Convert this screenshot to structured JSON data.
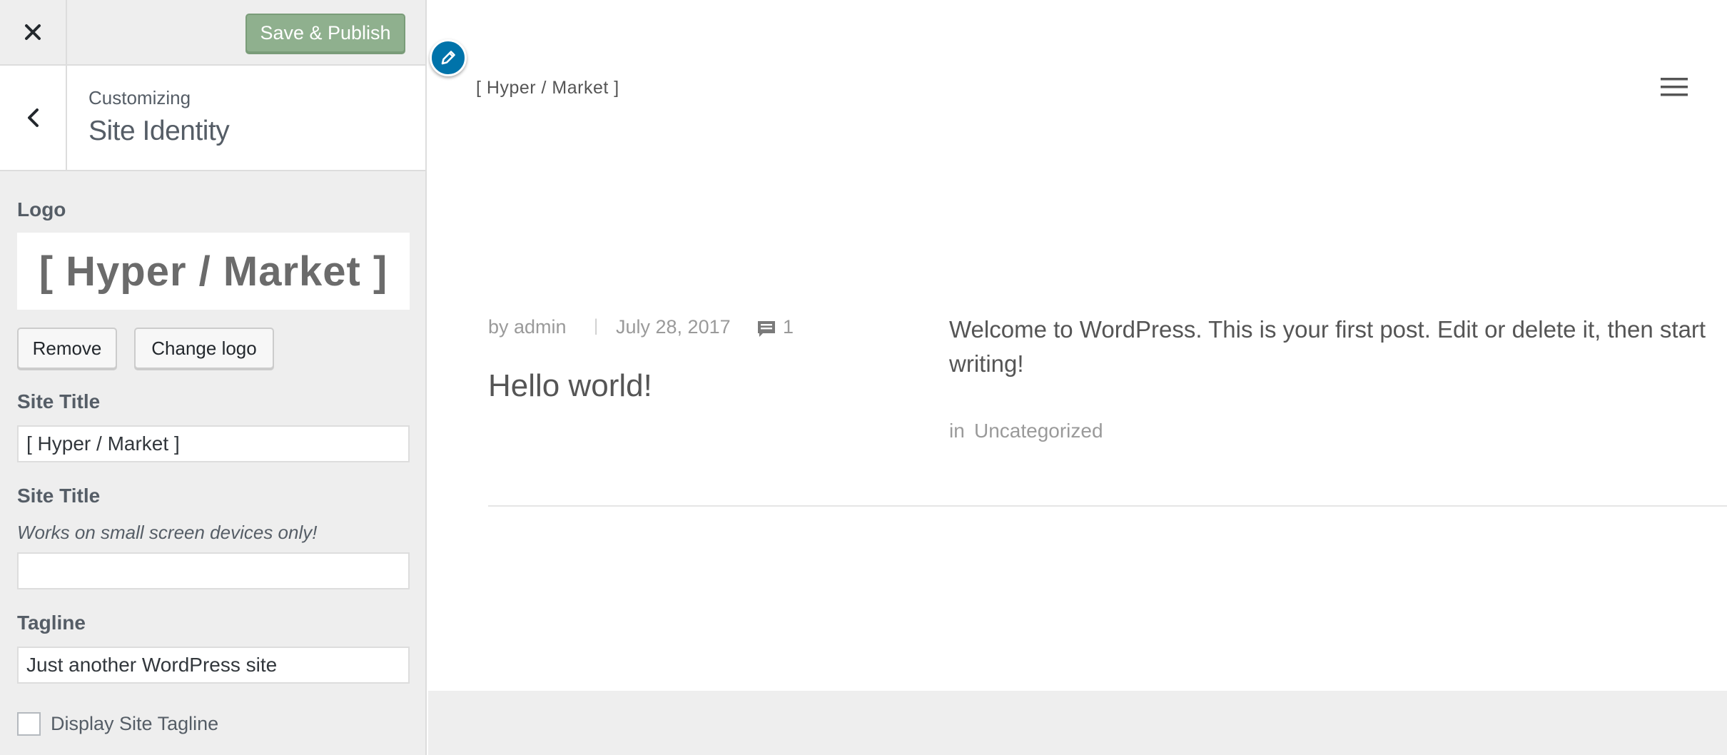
{
  "sidebar": {
    "save_label": "Save & Publish",
    "header": {
      "customizing": "Customizing",
      "title": "Site Identity"
    },
    "logo": {
      "label": "Logo",
      "preview_text": "[ Hyper / Market ]",
      "remove_label": "Remove",
      "change_label": "Change logo"
    },
    "site_title": {
      "label": "Site Title",
      "value": "[ Hyper / Market ]"
    },
    "site_title_small": {
      "label": "Site Title",
      "description": "Works on small screen devices only!",
      "value": ""
    },
    "tagline": {
      "label": "Tagline",
      "value": "Just another WordPress site"
    },
    "display_tagline": {
      "label": "Display Site Tagline",
      "checked": false
    }
  },
  "preview": {
    "site_brand": "[ Hyper / Market ]",
    "post": {
      "by": "by admin",
      "separator": "|",
      "date": "July 28, 2017",
      "comments": "1",
      "title": "Hello world!",
      "excerpt": "Welcome to WordPress. This is your first post. Edit or delete it, then start writing!",
      "category_prefix": "in",
      "category": "Uncategorized"
    }
  },
  "colors": {
    "accent": "#0073aa",
    "publish_button": "#8fb08e",
    "panel_bg": "#eeeeee"
  }
}
